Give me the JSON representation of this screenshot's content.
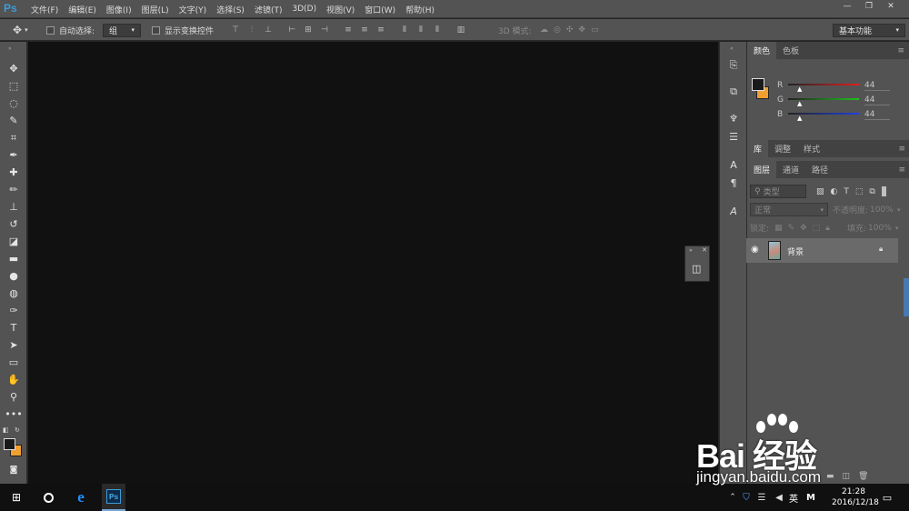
{
  "app": {
    "logo": "Ps"
  },
  "menu": [
    "文件(F)",
    "编辑(E)",
    "图像(I)",
    "图层(L)",
    "文字(Y)",
    "选择(S)",
    "滤镜(T)",
    "3D(D)",
    "视图(V)",
    "窗口(W)",
    "帮助(H)"
  ],
  "window_controls": {
    "minimize": "—",
    "restore": "❐",
    "close": "✕"
  },
  "options": {
    "auto_select_label": "自动选择:",
    "auto_select_value": "组",
    "show_transform_label": "显示变换控件",
    "mode_3d_label": "3D 模式:",
    "workspace_value": "基本功能"
  },
  "color_panel": {
    "tabs": [
      "颜色",
      "色板"
    ],
    "channels": [
      {
        "label": "R",
        "value": "44",
        "color": "#e02020"
      },
      {
        "label": "G",
        "value": "44",
        "color": "#20c020"
      },
      {
        "label": "B",
        "value": "44",
        "color": "#2040e0"
      }
    ]
  },
  "library_panel": {
    "tabs": [
      "库",
      "调整",
      "样式"
    ]
  },
  "layers_panel": {
    "tabs": [
      "图层",
      "通道",
      "路径"
    ],
    "filter_placeholder": "类型",
    "blend_mode": "正常",
    "opacity_label": "不透明度:",
    "opacity_value": "100%",
    "lock_label": "锁定:",
    "fill_label": "填充:",
    "fill_value": "100%",
    "layers": [
      {
        "name": "背景"
      }
    ]
  },
  "taskbar": {
    "ime": "英",
    "time": "21:28",
    "date": "2016/12/18"
  },
  "watermark": {
    "text": "Bai 经验",
    "url": "jingyan.baidu.com"
  },
  "colors": {
    "foreground": "#1a1a1a",
    "background": "#f0a030",
    "accent": "#3d9dd9"
  }
}
